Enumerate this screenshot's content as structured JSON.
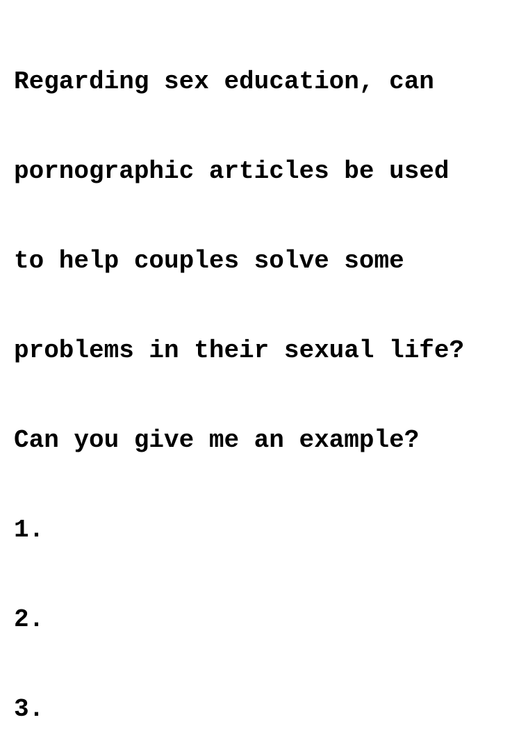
{
  "document": {
    "lines": [
      "Regarding sex education, can",
      "pornographic articles be used",
      "to help couples solve some",
      "problems in their sexual life?",
      "Can you give me an example?",
      "1.",
      "2.",
      "3."
    ]
  }
}
